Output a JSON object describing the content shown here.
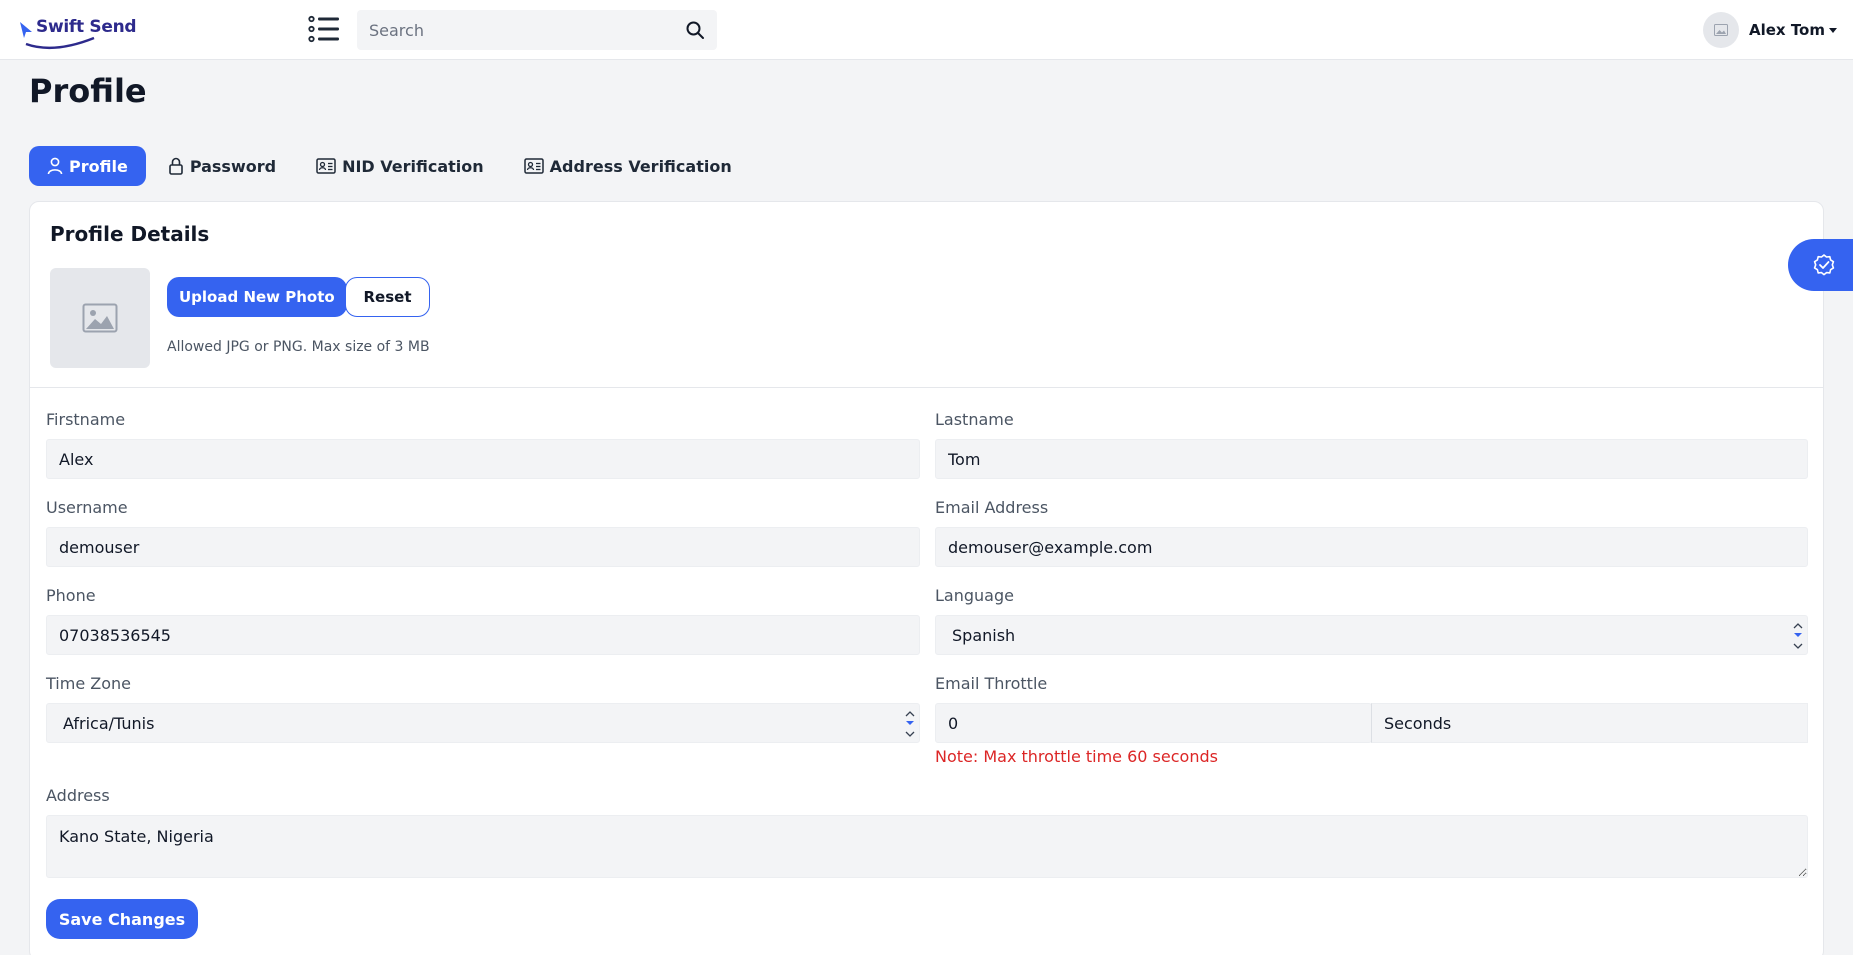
{
  "navbar": {
    "brand": "Swift Send",
    "search_placeholder": "Search",
    "user_name": "Alex Tom"
  },
  "page": {
    "title": "Profile"
  },
  "tabs": [
    {
      "label": "Profile",
      "icon": "user-icon",
      "active": true
    },
    {
      "label": "Password",
      "icon": "lock-icon",
      "active": false
    },
    {
      "label": "NID Verification",
      "icon": "id-card-icon",
      "active": false
    },
    {
      "label": "Address Verification",
      "icon": "id-card-icon",
      "active": false
    }
  ],
  "profile": {
    "section_title": "Profile Details",
    "upload_label": "Upload New Photo",
    "reset_label": "Reset",
    "photo_hint": "Allowed JPG or PNG. Max size of 3 MB"
  },
  "form": {
    "firstname": {
      "label": "Firstname",
      "value": "Alex"
    },
    "lastname": {
      "label": "Lastname",
      "value": "Tom"
    },
    "username": {
      "label": "Username",
      "value": "demouser"
    },
    "email": {
      "label": "Email Address",
      "value": "demouser@example.com"
    },
    "phone": {
      "label": "Phone",
      "value": "07038536545"
    },
    "language": {
      "label": "Language",
      "value": "Spanish"
    },
    "timezone": {
      "label": "Time Zone",
      "value": "Africa/Tunis"
    },
    "throttle": {
      "label": "Email Throttle",
      "value": "0",
      "unit": "Seconds",
      "note": "Note: Max throttle time 60 seconds"
    },
    "address": {
      "label": "Address",
      "value": "Kano State, Nigeria"
    },
    "save_label": "Save Changes"
  },
  "colors": {
    "primary": "#3563f0",
    "danger": "#dc2626",
    "brand": "#2d2a8c"
  }
}
